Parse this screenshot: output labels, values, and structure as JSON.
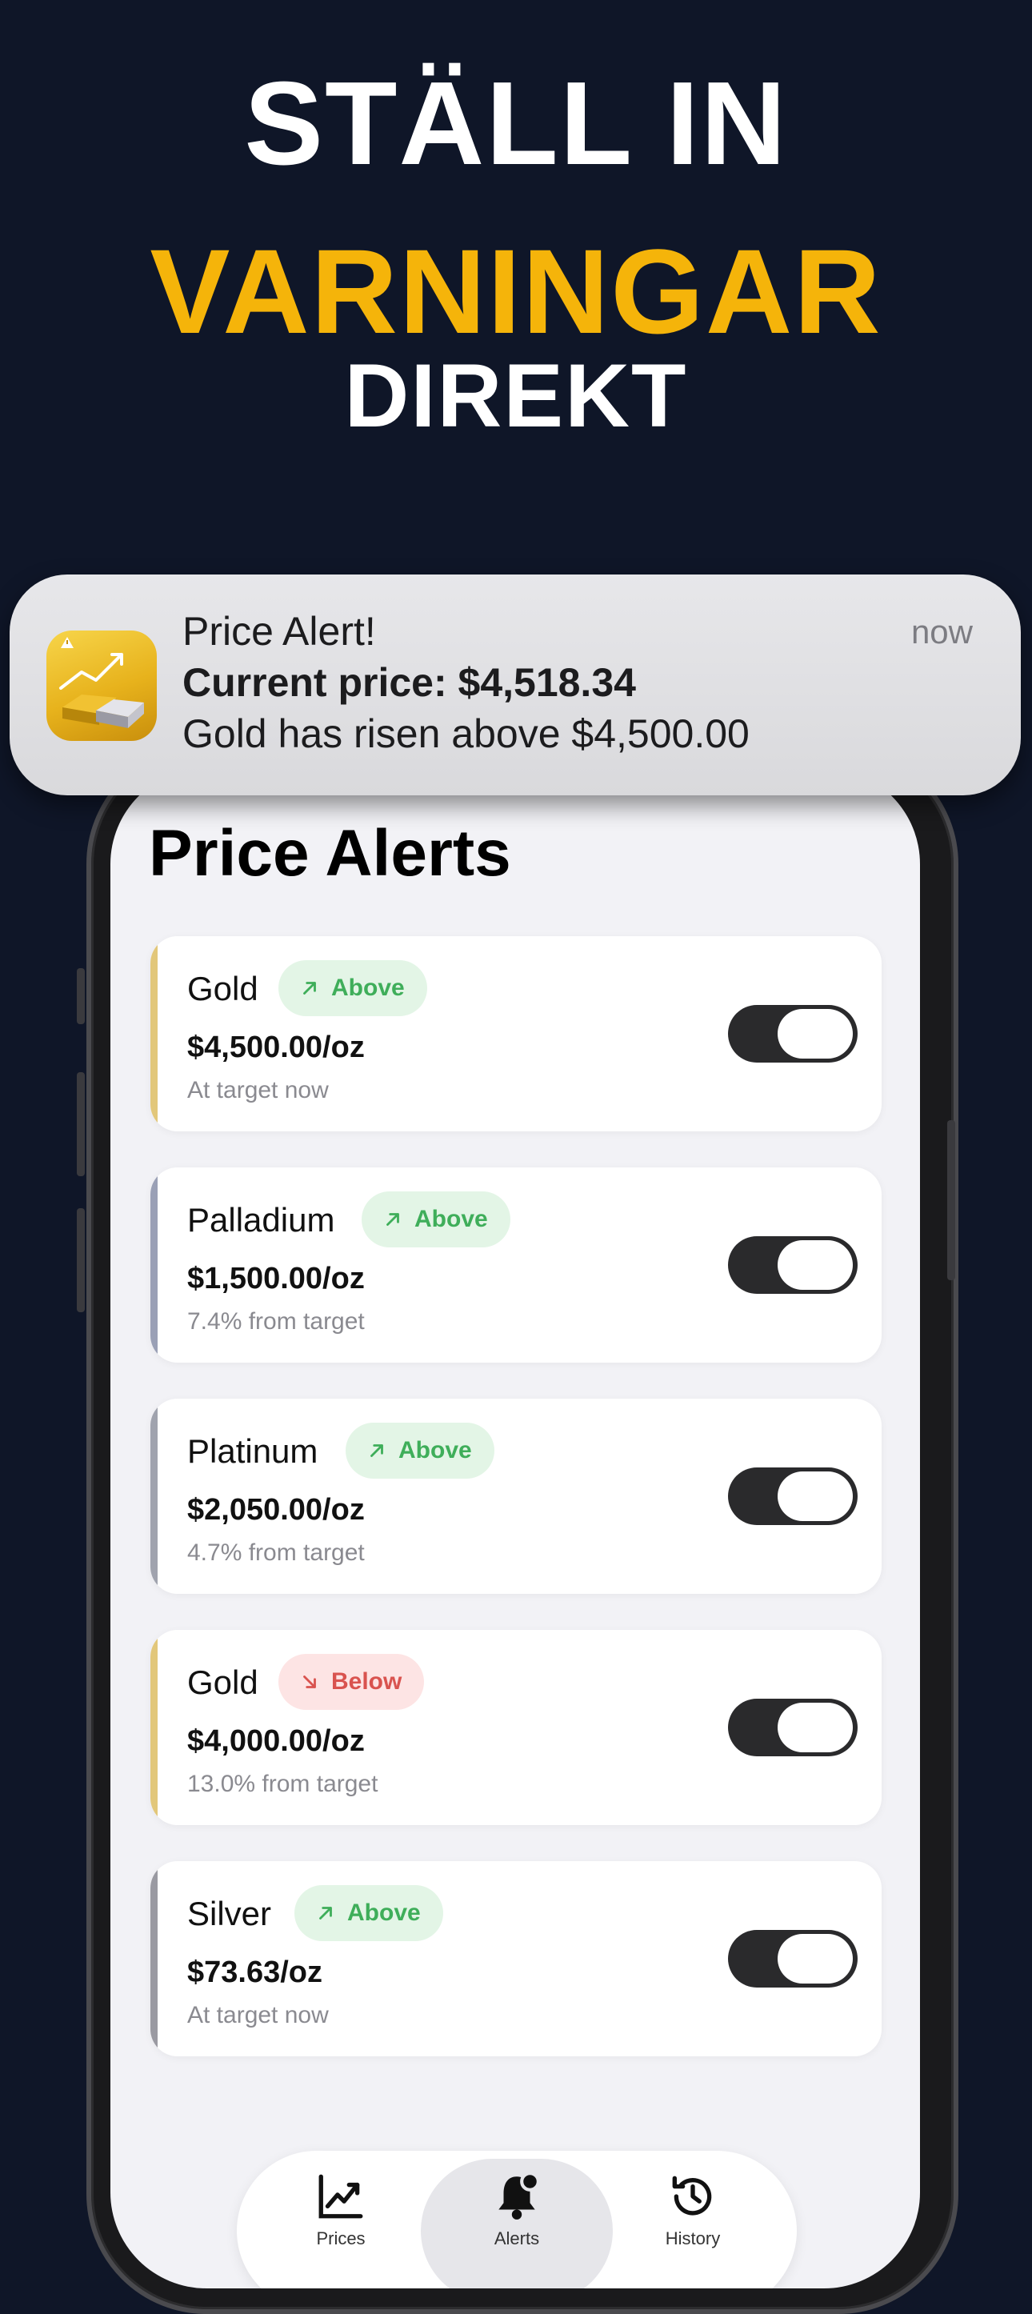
{
  "hero": {
    "line1": "STÄLL IN",
    "line2": "VARNINGAR",
    "line3": "DIREKT"
  },
  "notification": {
    "title": "Price Alert!",
    "line1": "Current price: $4,518.34",
    "line2": "Gold has risen above $4,500.00",
    "time": "now",
    "icon": "gold-bars-chart-icon"
  },
  "screen": {
    "title": "Price Alerts"
  },
  "alerts": [
    {
      "metal": "Gold",
      "direction": "Above",
      "price": "$4,500.00/oz",
      "status": "At target now",
      "enabled": true,
      "accent": "#e2c77a"
    },
    {
      "metal": "Palladium",
      "direction": "Above",
      "price": "$1,500.00/oz",
      "status": "7.4% from target",
      "enabled": true,
      "accent": "#9aa0b6"
    },
    {
      "metal": "Platinum",
      "direction": "Above",
      "price": "$2,050.00/oz",
      "status": "4.7% from target",
      "enabled": true,
      "accent": "#a0a3ae"
    },
    {
      "metal": "Gold",
      "direction": "Below",
      "price": "$4,000.00/oz",
      "status": "13.0% from target",
      "enabled": true,
      "accent": "#e2c77a"
    },
    {
      "metal": "Silver",
      "direction": "Above",
      "price": "$73.63/oz",
      "status": "At target now",
      "enabled": true,
      "accent": "#9a9aa2"
    }
  ],
  "tabbar": {
    "items": [
      {
        "label": "Prices",
        "icon": "chart-icon"
      },
      {
        "label": "Alerts",
        "icon": "bell-icon",
        "active": true
      },
      {
        "label": "History",
        "icon": "history-icon"
      }
    ]
  },
  "colors": {
    "background": "#0f1628",
    "accent_yellow": "#f5b40a",
    "above_green": "#3fae5a",
    "below_red": "#d9534f"
  }
}
